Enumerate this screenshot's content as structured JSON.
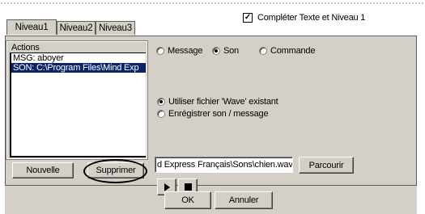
{
  "header": {
    "completer_label": "Compléter Texte et Niveau 1",
    "completer_checked": true
  },
  "tabs": [
    {
      "label": "Niveau1",
      "active": true
    },
    {
      "label": "Niveau2",
      "active": false
    },
    {
      "label": "Niveau3",
      "active": false
    }
  ],
  "actions": {
    "group_label": "Actions",
    "items": [
      {
        "text": "MSG: aboyer",
        "selected": false
      },
      {
        "text": "SON: C:\\Program Files\\Mind Exp",
        "selected": true
      }
    ],
    "new_button": "Nouvelle",
    "delete_button": "Supprimer"
  },
  "type_options": {
    "message": "Message",
    "son": "Son",
    "commande": "Commande",
    "selected": "son"
  },
  "source_options": {
    "existing": "Utiliser fichier 'Wave' existant",
    "record": "Enrégistrer son / message",
    "selected": "existing"
  },
  "file": {
    "path": "d Express Français\\Sons\\chien.wav",
    "browse_button": "Parcourir"
  },
  "playback": {
    "play_icon": "play-icon",
    "stop_icon": "stop-icon"
  },
  "dialog": {
    "ok": "OK",
    "cancel": "Annuler"
  },
  "colors": {
    "selection": "#0a246a",
    "face": "#d4d0c8"
  }
}
